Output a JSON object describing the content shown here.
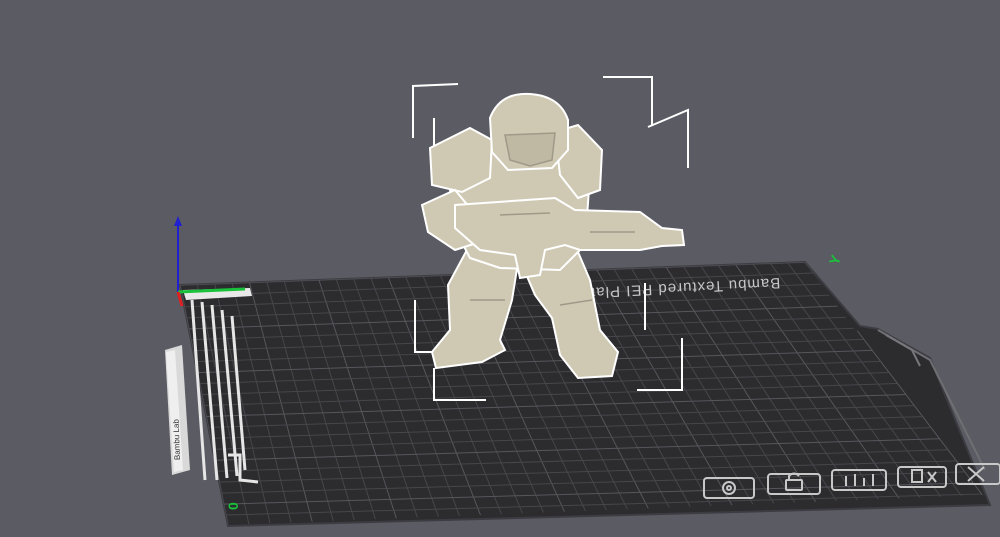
{
  "viewport": {
    "background": "#5b5b63",
    "plate": {
      "label": "Bambu Textured PEI Plate",
      "color": "#2c2c2f",
      "grid_color": "#46464b",
      "origin_label": "0",
      "y_axis_label": "Y"
    },
    "model": {
      "name": "armored soldier miniature with rifle",
      "color": "#cfc9b4",
      "outline_color": "#ffffff",
      "selected": true
    },
    "axes": {
      "x_color": "#e02020",
      "y_color": "#19c23a",
      "z_color": "#2020d0"
    },
    "bottom_toolbar": [
      {
        "name": "plate-settings-icon",
        "label": "settings"
      },
      {
        "name": "lock-icon",
        "label": "lock"
      },
      {
        "name": "arrange-icon",
        "label": "arrange"
      },
      {
        "name": "auto-orient-icon",
        "label": "orient"
      },
      {
        "name": "delete-plate-icon",
        "label": "delete"
      }
    ]
  }
}
